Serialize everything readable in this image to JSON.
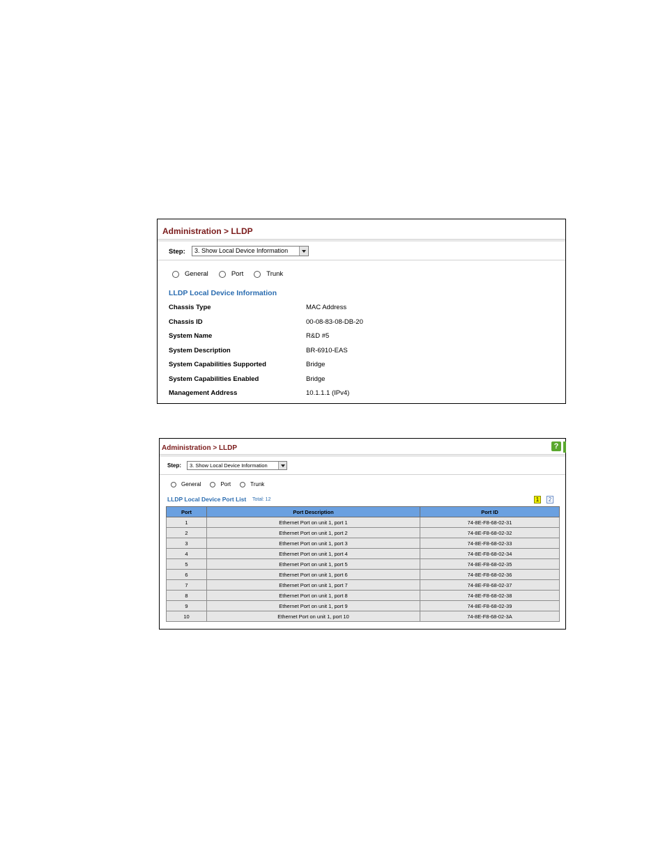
{
  "panel1": {
    "title": "Administration > LLDP",
    "step_label": "Step:",
    "step_value": "3. Show Local Device Information",
    "radios": [
      {
        "label": "General",
        "selected": true
      },
      {
        "label": "Port",
        "selected": false
      },
      {
        "label": "Trunk",
        "selected": false
      }
    ],
    "section_title": "LLDP Local Device Information",
    "fields": [
      {
        "label": "Chassis Type",
        "value": "MAC Address"
      },
      {
        "label": "Chassis ID",
        "value": "00-08-83-08-DB-20"
      },
      {
        "label": "System Name",
        "value": "R&D #5"
      },
      {
        "label": "System Description",
        "value": "BR-6910-EAS"
      },
      {
        "label": "System Capabilities Supported",
        "value": "Bridge"
      },
      {
        "label": "System Capabilities Enabled",
        "value": "Bridge"
      },
      {
        "label": "Management Address",
        "value": "10.1.1.1 (IPv4)"
      }
    ]
  },
  "panel2": {
    "title": "Administration > LLDP",
    "help_icon_label": "?",
    "step_label": "Step:",
    "step_value": "3. Show Local Device Information",
    "radios": [
      {
        "label": "General",
        "selected": false
      },
      {
        "label": "Port",
        "selected": true
      },
      {
        "label": "Trunk",
        "selected": false
      }
    ],
    "section_title": "LLDP Local Device Port List",
    "total_text": "Total: 12",
    "pages": [
      "1",
      "2"
    ],
    "active_page": "1",
    "columns": [
      "Port",
      "Port Description",
      "Port ID"
    ],
    "rows": [
      [
        "1",
        "Ethernet Port on unit 1, port 1",
        "74-8E-F8-68-02-31"
      ],
      [
        "2",
        "Ethernet Port on unit 1, port 2",
        "74-8E-F8-68-02-32"
      ],
      [
        "3",
        "Ethernet Port on unit 1, port 3",
        "74-8E-F8-68-02-33"
      ],
      [
        "4",
        "Ethernet Port on unit 1, port 4",
        "74-8E-F8-68-02-34"
      ],
      [
        "5",
        "Ethernet Port on unit 1, port 5",
        "74-8E-F8-68-02-35"
      ],
      [
        "6",
        "Ethernet Port on unit 1, port 6",
        "74-8E-F8-68-02-36"
      ],
      [
        "7",
        "Ethernet Port on unit 1, port 7",
        "74-8E-F8-68-02-37"
      ],
      [
        "8",
        "Ethernet Port on unit 1, port 8",
        "74-8E-F8-68-02-38"
      ],
      [
        "9",
        "Ethernet Port on unit 1, port 9",
        "74-8E-F8-68-02-39"
      ],
      [
        "10",
        "Ethernet Port on unit 1, port 10",
        "74-8E-F8-68-02-3A"
      ]
    ]
  }
}
